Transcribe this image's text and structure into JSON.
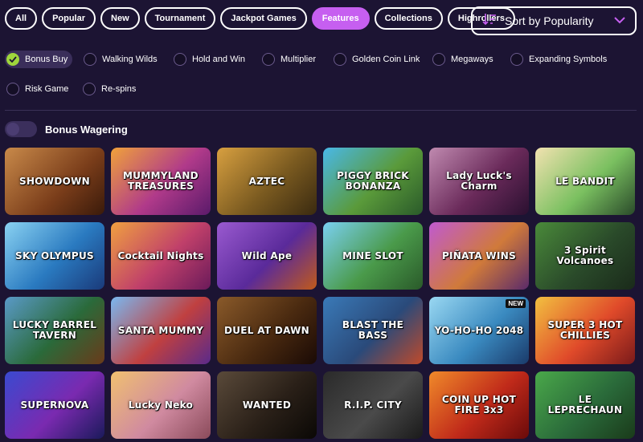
{
  "filter_tabs": [
    "All",
    "Popular",
    "New",
    "Tournament",
    "Jackpot Games",
    "Features",
    "Collections",
    "Highrollers"
  ],
  "active_tab": "Features",
  "sort": {
    "label": "Sort by Popularity"
  },
  "feature_chips": [
    {
      "label": "Bonus Buy",
      "checked": true
    },
    {
      "label": "Walking Wilds",
      "checked": false
    },
    {
      "label": "Hold and Win",
      "checked": false
    },
    {
      "label": "Multiplier",
      "checked": false
    },
    {
      "label": "Golden Coin Link",
      "checked": false
    },
    {
      "label": "Megaways",
      "checked": false
    },
    {
      "label": "Expanding Symbols",
      "checked": false
    },
    {
      "label": "Risk Game",
      "checked": false
    },
    {
      "label": "Re-spins",
      "checked": false
    }
  ],
  "bonus_wagering": {
    "label": "Bonus Wagering",
    "enabled": false
  },
  "colors": {
    "accent": "#c65ff0",
    "check": "#9fd63c",
    "background": "#1c1433"
  },
  "games": [
    {
      "title": "SHOWDOWN"
    },
    {
      "title": "MUMMYLAND TREASURES"
    },
    {
      "title": "AZTEC"
    },
    {
      "title": "PIGGY BRICK BONANZA"
    },
    {
      "title": "Lady Luck's Charm"
    },
    {
      "title": "LE BANDIT"
    },
    {
      "title": "SKY OLYMPUS"
    },
    {
      "title": "Cocktail Nights"
    },
    {
      "title": "Wild Ape"
    },
    {
      "title": "MINE SLOT"
    },
    {
      "title": "PIÑATA WINS"
    },
    {
      "title": "3 Spirit Volcanoes"
    },
    {
      "title": "LUCKY BARREL TAVERN"
    },
    {
      "title": "SANTA MUMMY"
    },
    {
      "title": "DUEL AT DAWN"
    },
    {
      "title": "BLAST THE BASS"
    },
    {
      "title": "YO-HO-HO 2048",
      "badge": "NEW"
    },
    {
      "title": "SUPER 3 HOT CHILLIES"
    },
    {
      "title": "SUPERNOVA"
    },
    {
      "title": "Lucky Neko"
    },
    {
      "title": "WANTED"
    },
    {
      "title": "R.I.P. CITY"
    },
    {
      "title": "COIN UP HOT FIRE 3x3"
    },
    {
      "title": "LE LEPRECHAUN"
    }
  ]
}
